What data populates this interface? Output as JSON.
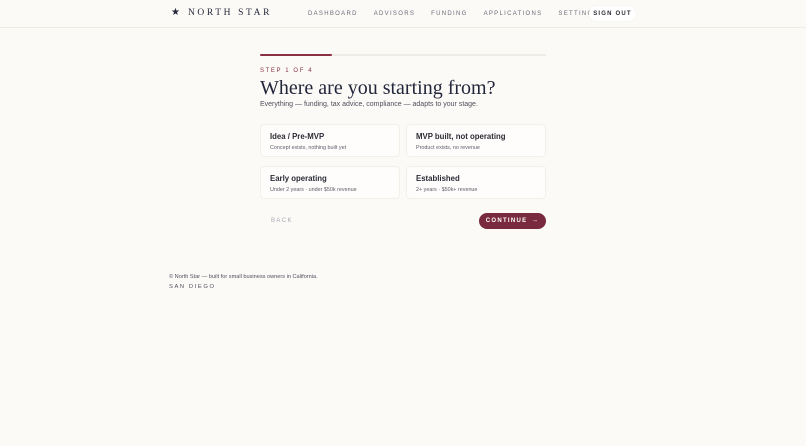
{
  "header": {
    "brand_icon": "★",
    "brand_name": "NORTH STAR",
    "nav": [
      "DASHBOARD",
      "ADVISORS",
      "FUNDING",
      "APPLICATIONS",
      "SETTINGS"
    ],
    "sign_out_label": "SIGN OUT"
  },
  "progress": {
    "current_step": 1,
    "total_steps": 4,
    "fill_fraction": 0.25,
    "color": "#8a2f44"
  },
  "main": {
    "step_label": "STEP 1 OF 4",
    "title": "Where are you starting from?",
    "subtitle": "Everything — funding, tax advice, compliance — adapts to your stage.",
    "options": [
      {
        "title": "Idea / Pre-MVP",
        "description": "Concept exists, nothing built yet"
      },
      {
        "title": "MVP built, not operating",
        "description": "Product exists, no revenue"
      },
      {
        "title": "Early operating",
        "description": "Under 2 years · under $50k revenue"
      },
      {
        "title": "Established",
        "description": "2+ years · $50k+ revenue"
      }
    ],
    "back_label": "BACK",
    "continue_label": "CONTINUE",
    "continue_icon": "→"
  },
  "footer": {
    "copyright": "© North Star — built for small business owners in California.",
    "city": "SAN DIEGO"
  },
  "colors": {
    "background": "#fcfaf7",
    "accent": "#7a2a3e",
    "text": "#2a2a35"
  }
}
